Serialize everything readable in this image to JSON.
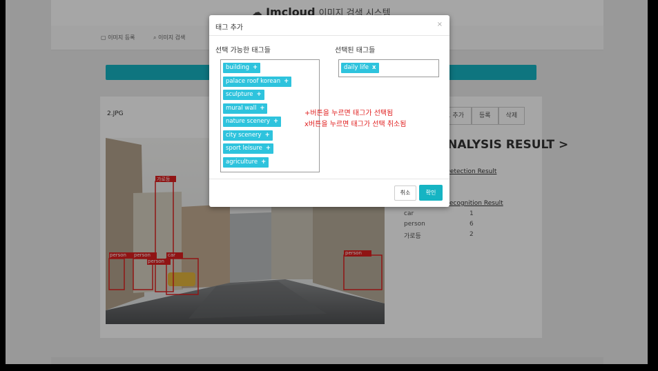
{
  "header": {
    "logo": "Imcloud",
    "subtitle": "이미지 검색 시스템"
  },
  "nav": {
    "register_label": "이미지 등록",
    "search_label": "이미지 검색"
  },
  "card": {
    "filename": "2.JPG",
    "buttons": {
      "add_tag": "태그 추가",
      "register": "등록",
      "delete": "삭제"
    },
    "analysis_title": "ANALYSIS RESULT >",
    "detection_link": "Detection Result",
    "recognition_link": "Recognition Result",
    "results": [
      {
        "label": "car",
        "count": "1"
      },
      {
        "label": "person",
        "count": "6"
      },
      {
        "label": "가로등",
        "count": "2"
      }
    ],
    "photo_labels": [
      "가로등",
      "person",
      "person",
      "person",
      "car",
      "person"
    ]
  },
  "modal": {
    "title": "태그 추가",
    "close_symbol": "×",
    "available_label": "선택 가능한 태그들",
    "selected_label": "선택된 태그들",
    "available_tags": [
      "building",
      "palace roof korean",
      "sculpture",
      "mural wall",
      "nature scenery",
      "city scenery",
      "sport leisure",
      "agriculture"
    ],
    "selected_tags": [
      "daily life"
    ],
    "add_symbol": "+",
    "remove_symbol": "x",
    "cancel_label": "취소",
    "confirm_label": "확인"
  },
  "annotations": {
    "line1": "+버튼을 누르면 태그가 선택됨",
    "line2": "x버튼을 누르면 태그가 선택 취소됨"
  },
  "colors": {
    "accent": "#16b4c3",
    "tag": "#2ec3dd",
    "annotation": "#e02020",
    "bbox": "#dd2020"
  }
}
